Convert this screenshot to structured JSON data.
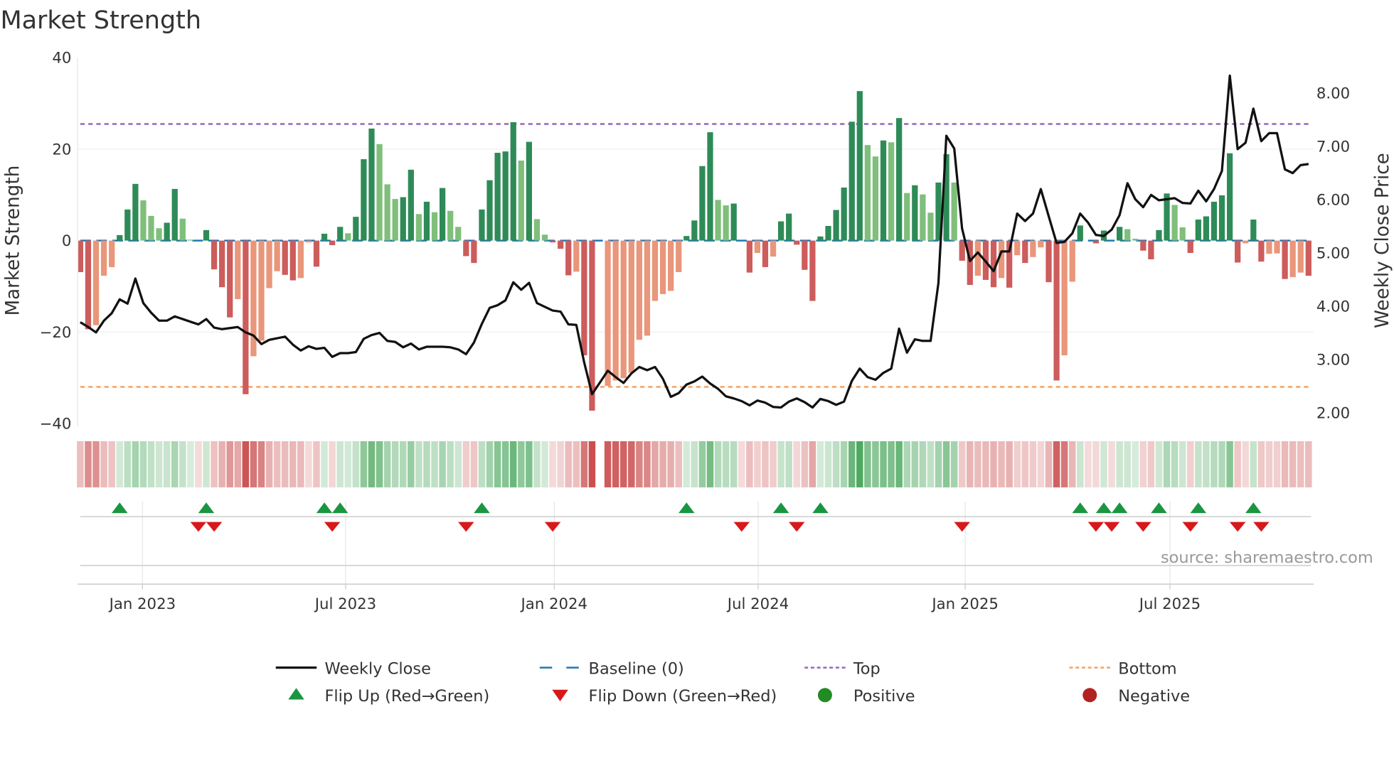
{
  "chart_data": {
    "type": "bar",
    "title": "Market Strength",
    "ylabel": "Market Strength",
    "y2label": "Weekly Close Price",
    "ylim": [
      -40,
      40
    ],
    "y2lim": [
      1.7,
      8.6
    ],
    "yticks": [
      "40",
      "20",
      "0",
      "−20",
      "−40"
    ],
    "ytick_values": [
      40,
      20,
      0,
      -20,
      -40
    ],
    "y2ticks": [
      "8.00",
      "7.00",
      "6.00",
      "5.00",
      "4.00",
      "3.00",
      "2.00"
    ],
    "y2tick_values": [
      8,
      7,
      6,
      5,
      4,
      3,
      2
    ],
    "xticks": [
      {
        "label": "Jan 2023",
        "week": 7.9
      },
      {
        "label": "Jul 2023",
        "week": 33.7
      },
      {
        "label": "Jan 2024",
        "week": 60.2
      },
      {
        "label": "Jul 2024",
        "week": 86.1
      },
      {
        "label": "Jan 2025",
        "week": 112.4
      },
      {
        "label": "Jul 2025",
        "week": 138.4
      }
    ],
    "grid": true,
    "top_level": 25.5,
    "bottom_level": -32,
    "baseline": 0,
    "strength": [
      -6.9,
      -19.4,
      -18.5,
      -7.7,
      -5.8,
      1.2,
      6.8,
      12.4,
      8.8,
      5.4,
      2.7,
      3.9,
      11.3,
      4.8,
      0.2,
      0,
      2.3,
      -6.3,
      -10.2,
      -16.8,
      -12.8,
      -33.6,
      -25.3,
      -21.9,
      -10.4,
      -6.7,
      -7.5,
      -8.7,
      -8.2,
      -0.4,
      -5.7,
      1.5,
      -1.0,
      3.0,
      1.6,
      5.2,
      17.8,
      24.5,
      21.1,
      12.3,
      9.1,
      9.5,
      15.5,
      5.8,
      8.5,
      6.2,
      11.5,
      6.5,
      3.0,
      -3.4,
      -4.9,
      6.8,
      13.2,
      19.2,
      19.5,
      25.9,
      17.5,
      21.6,
      4.7,
      1.3,
      -0.4,
      -1.8,
      -7.6,
      -6.8,
      -25.1,
      -37.2,
      null,
      -31.8,
      -30.6,
      -30.1,
      -28.9,
      -21.7,
      -20.8,
      -13.2,
      -11.7,
      -11.0,
      -6.9,
      1.0,
      4.4,
      16.3,
      23.7,
      8.9,
      7.7,
      8.1,
      0,
      -7.0,
      -2.7,
      -5.8,
      -3.5,
      4.2,
      5.9,
      -0.9,
      -6.4,
      -13.2,
      0.9,
      3.2,
      6.7,
      11.6,
      26.0,
      32.7,
      20.9,
      18.4,
      21.9,
      21.5,
      26.8,
      10.4,
      12.1,
      10.1,
      6.1,
      12.7,
      18.9,
      12.7,
      -4.4,
      -9.7,
      -7.7,
      -8.6,
      -10.2,
      -8.2,
      -10.3,
      -3.2,
      -4.9,
      -3.6,
      -1.5,
      -9.1,
      -30.6,
      -25.1,
      -9.0,
      3.3,
      0,
      -0.6,
      2.2,
      0,
      3.0,
      2.5,
      0.4,
      -2.2,
      -4.1,
      2.3,
      10.3,
      7.8,
      2.9,
      -2.7,
      4.6,
      5.3,
      8.5,
      9.9,
      19.1,
      -4.8,
      -0.6,
      4.6,
      -4.6,
      -2.9,
      -2.8,
      -8.4,
      -8.0,
      -7.0,
      -7.7
    ],
    "weekly_close": [
      3.7,
      3.61,
      3.51,
      3.73,
      3.87,
      4.13,
      4.05,
      4.52,
      4.06,
      3.88,
      3.73,
      3.73,
      3.81,
      3.76,
      3.71,
      3.66,
      3.76,
      3.6,
      3.57,
      3.59,
      3.61,
      3.51,
      3.45,
      3.29,
      3.37,
      3.4,
      3.43,
      3.28,
      3.17,
      3.25,
      3.2,
      3.22,
      3.05,
      3.12,
      3.12,
      3.14,
      3.39,
      3.46,
      3.5,
      3.35,
      3.33,
      3.23,
      3.3,
      3.19,
      3.24,
      3.24,
      3.24,
      3.23,
      3.19,
      3.1,
      3.32,
      3.67,
      3.97,
      4.02,
      4.11,
      4.45,
      4.31,
      4.44,
      4.06,
      3.99,
      3.92,
      3.9,
      3.66,
      3.65,
      2.95,
      2.35,
      2.57,
      2.79,
      2.67,
      2.56,
      2.74,
      2.86,
      2.8,
      2.86,
      2.64,
      2.3,
      2.37,
      2.53,
      2.59,
      2.68,
      2.55,
      2.45,
      2.31,
      2.27,
      2.22,
      2.14,
      2.23,
      2.19,
      2.11,
      2.1,
      2.21,
      2.27,
      2.2,
      2.1,
      2.26,
      2.22,
      2.15,
      2.21,
      2.6,
      2.83,
      2.67,
      2.62,
      2.75,
      2.83,
      3.58,
      3.13,
      3.38,
      3.35,
      3.35,
      4.44,
      7.2,
      6.96,
      5.46,
      4.85,
      5.01,
      4.84,
      4.66,
      5.03,
      5.03,
      5.74,
      5.6,
      5.74,
      6.2,
      5.69,
      5.19,
      5.21,
      5.37,
      5.74,
      5.57,
      5.34,
      5.32,
      5.44,
      5.71,
      6.31,
      6.01,
      5.86,
      6.09,
      5.99,
      6.01,
      6.03,
      5.94,
      5.93,
      6.17,
      5.97,
      6.2,
      6.54,
      8.33,
      6.95,
      7.07,
      7.71,
      7.1,
      7.25,
      7.25,
      6.57,
      6.5,
      6.65,
      6.67
    ],
    "flip_up_weeks": [
      6,
      17,
      32,
      34,
      52,
      78,
      90,
      95,
      128,
      131,
      133,
      138,
      143,
      150
    ],
    "flip_down_weeks": [
      16,
      18,
      33,
      50,
      61,
      85,
      92,
      113,
      130,
      132,
      136,
      142,
      148,
      151
    ],
    "legend": {
      "placement": "bottom",
      "items": [
        {
          "label": "Weekly Close",
          "kind": "line"
        },
        {
          "label": "Baseline (0)",
          "kind": "dash"
        },
        {
          "label": "Top",
          "kind": "dot-purple"
        },
        {
          "label": "Bottom",
          "kind": "dot-orange"
        },
        {
          "label": "Flip Up (Red→Green)",
          "kind": "tri-up"
        },
        {
          "label": "Flip Down (Green→Red)",
          "kind": "tri-down"
        },
        {
          "label": "Positive",
          "kind": "dot-green"
        },
        {
          "label": "Negative",
          "kind": "dot-red"
        }
      ]
    },
    "annotation": "source: sharemaestro.com"
  },
  "colors": {
    "up_strong": "#2e8b57",
    "up_weak": "#7fbf7b",
    "down_strong": "#cd5c5c",
    "down_weak": "#e9967a",
    "baseline": "#1f77b4",
    "top": "#9467bd",
    "bottom": "#f4a261",
    "flip_up": "#1a9641",
    "flip_down": "#d7191c",
    "positive": "#228b22",
    "negative": "#b22222",
    "line": "#111111"
  }
}
